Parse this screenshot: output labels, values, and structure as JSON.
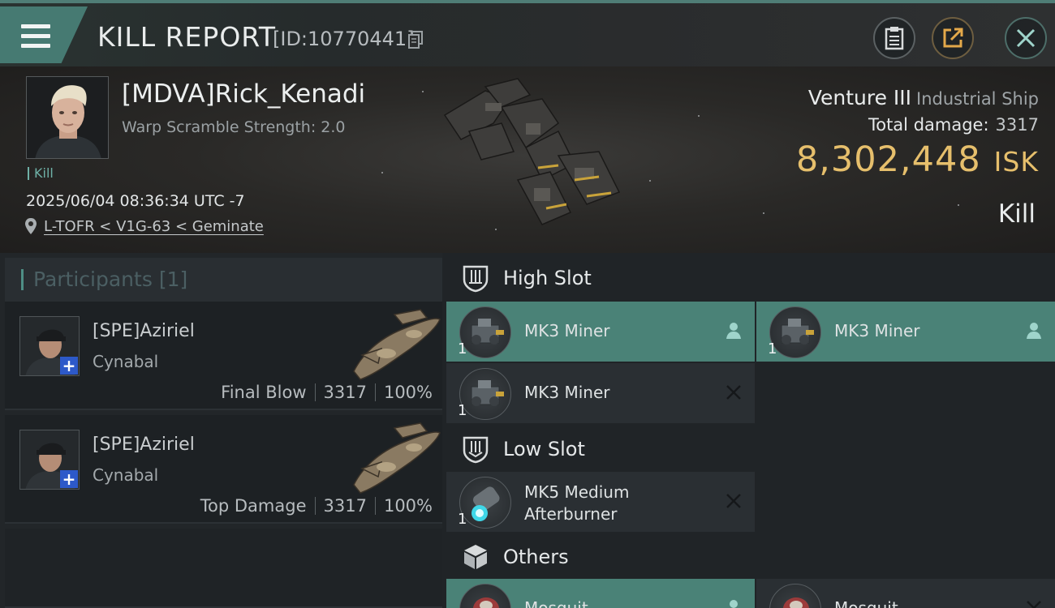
{
  "header": {
    "title": "KILL REPORT",
    "report_id": "[ID:10770441]",
    "icons": [
      "menu-icon",
      "copy-icon",
      "clipboard-icon",
      "share-icon",
      "close-icon"
    ]
  },
  "victim": {
    "name": "[MDVA]Rick_Kenadi",
    "warp_scramble": "Warp Scramble Strength: 2.0",
    "kill_tag": "Kill",
    "timestamp": "2025/06/04 08:36:34 UTC -7",
    "location": "L-TOFR < V1G-63 < Geminate",
    "ship_name": "Venture III",
    "ship_class": "Industrial Ship",
    "total_damage_label": "Total damage:",
    "total_damage_value": "3317",
    "isk_value": "8,302,448",
    "isk_unit": "ISK",
    "result": "Kill"
  },
  "participants": {
    "title": "Participants",
    "count": "[1]",
    "rows": [
      {
        "name": "[SPE]Aziriel",
        "ship": "Cynabal",
        "role": "Final Blow",
        "damage": "3317",
        "percent": "100%"
      },
      {
        "name": "[SPE]Aziriel",
        "ship": "Cynabal",
        "role": "Top Damage",
        "damage": "3317",
        "percent": "100%"
      }
    ]
  },
  "slots": {
    "high": {
      "label": "High Slot",
      "modules": [
        {
          "name": "MK3 Miner",
          "qty": "1",
          "state": "person-icon"
        },
        {
          "name": "MK3 Miner",
          "qty": "1",
          "state": "person-icon"
        },
        {
          "name": "MK3 Miner",
          "qty": "1",
          "state": "destroyed-x-icon"
        }
      ]
    },
    "low": {
      "label": "Low Slot",
      "modules": [
        {
          "name_line1": "MK5 Medium",
          "name_line2": "Afterburner",
          "qty": "1",
          "state": "destroyed-x-icon"
        }
      ]
    },
    "others": {
      "label": "Others",
      "modules": [
        {
          "name": "Mosquit",
          "state": "person-icon"
        },
        {
          "name": "Mosquit",
          "state": "destroyed-x-icon"
        }
      ]
    }
  },
  "colors": {
    "accent_teal": "#4a8277",
    "isk_gold": "#e6bf6c",
    "background": "#1b1e21"
  }
}
